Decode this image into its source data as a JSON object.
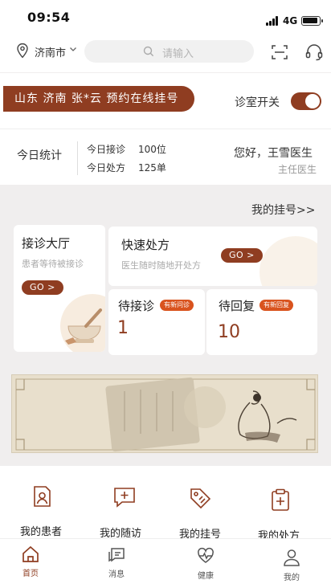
{
  "status": {
    "time": "09:54",
    "network": "4G"
  },
  "header": {
    "city": "济南市",
    "search_placeholder": "请输入"
  },
  "banner": {
    "text": "山东 济南 张*云 预约在线挂号",
    "room_switch_label": "诊室开关",
    "room_switch_on": true
  },
  "stats": {
    "title": "今日统计",
    "rows": [
      {
        "label": "今日接诊",
        "value": "100位"
      },
      {
        "label": "今日处方",
        "value": "125单"
      }
    ],
    "greeting": "您好，王雪医生",
    "doctor_title": "主任医生"
  },
  "my_registration_link": "我的挂号>>",
  "cards": {
    "hall": {
      "title": "接诊大厅",
      "subtitle": "患者等待被接诊",
      "go": "GO >"
    },
    "quick": {
      "title": "快速处方",
      "subtitle": "医生随时随地开处方",
      "go": "GO >"
    },
    "waiting": {
      "title": "待接诊",
      "badge": "有新问诊",
      "count": "1"
    },
    "reply": {
      "title": "待回复",
      "badge": "有新回复",
      "count": "10"
    }
  },
  "quick_grid": [
    {
      "label": "我的患者",
      "icon": "patient-record-icon"
    },
    {
      "label": "我的随访",
      "icon": "followup-chat-icon"
    },
    {
      "label": "我的挂号",
      "icon": "tag-icon"
    },
    {
      "label": "我的处方",
      "icon": "prescription-clipboard-icon"
    }
  ],
  "tabbar": [
    {
      "label": "首页",
      "icon": "home-icon",
      "active": true
    },
    {
      "label": "消息",
      "icon": "message-icon",
      "active": false
    },
    {
      "label": "健康",
      "icon": "health-heart-icon",
      "active": false
    },
    {
      "label": "我的",
      "icon": "user-icon",
      "active": false
    }
  ],
  "colors": {
    "brand": "#8f3d21",
    "badge": "#d9531e",
    "background": "#f5f4f4"
  }
}
